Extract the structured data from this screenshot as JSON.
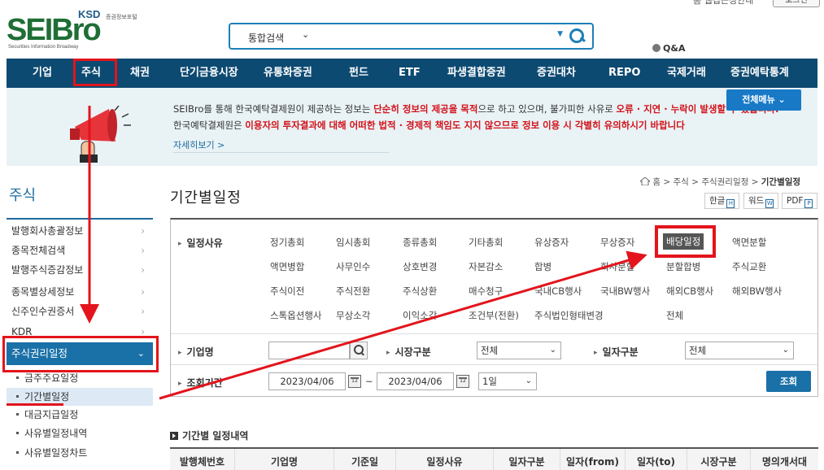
{
  "header": {
    "logo_main": "SEIBro",
    "logo_ksd": "KSD",
    "logo_ksd_sub": "증권정보포털",
    "logo_tagline": "Securities Information Broadway",
    "search_scope": "통합검색",
    "qa_label": "Q&A",
    "top_links": "홈  웹접근성안내",
    "login_label": "로그인"
  },
  "nav": {
    "items": [
      "기업",
      "주식",
      "채권",
      "단기금융시장",
      "유통화증권",
      "펀드",
      "ETF",
      "파생결합증권",
      "증권대차",
      "REPO",
      "국제거래",
      "증권예탁통계"
    ]
  },
  "notice": {
    "line1_a": "SEIBro를 통해 한국예탁결제원이 제공하는 정보는 ",
    "line1_b": "단순히 정보의 제공을 목적",
    "line1_c": "으로 하고 있으며, 불가피한 사유로 ",
    "line1_d": "오류 · 지연 · 누락이 발생할 수 있습니다.",
    "line2_a": "한국예탁결제원은 ",
    "line2_b": "이용자의 투자결과에 대해 어떠한 법적 · 경제적 책임도 지지 않으므로 정보 이용 시 각별히 유의하시기 바랍니다",
    "more": "자세히보기  >",
    "full_menu": "전체메뉴  ⌄"
  },
  "sidebar": {
    "title": "주식",
    "items": [
      "발행회사총괄정보",
      "종목전체검색",
      "발행주식증감정보",
      "종목별상세정보",
      "신주인수권증서",
      "KDR"
    ],
    "active": "주식권리일정",
    "sub_items": [
      "금주주요일정",
      "기간별일정",
      "대금지급일정",
      "사유별일정내역",
      "사유별일정차트"
    ]
  },
  "main": {
    "title": "기간별일정",
    "breadcrumb": {
      "home": "홈",
      "level1": "주식",
      "level2": "주식권리일정",
      "current": "기간별일정"
    },
    "downloads": [
      "한글",
      "워드",
      "PDF"
    ],
    "filter": {
      "reason_label": "일정사유",
      "reasons": [
        [
          "정기총회",
          "임시총회",
          "종류총회",
          "기타총회",
          "유상증자",
          "무상증자",
          "배당일정",
          "액면분할"
        ],
        [
          "액면병합",
          "사무인수",
          "상호변경",
          "자본감소",
          "합병",
          "회사분할",
          "분할합병",
          "주식교환"
        ],
        [
          "주식이전",
          "주식전환",
          "주식상환",
          "매수청구",
          "국내CB행사",
          "국내BW행사",
          "해외CB행사",
          "해외BW행사"
        ],
        [
          "스톡옵션행사",
          "무상소각",
          "이익소각",
          "조건부(전환)",
          "주식법인형태변경",
          "",
          "전체",
          ""
        ]
      ],
      "company_label": "기업명",
      "company_value": "",
      "market_label": "시장구분",
      "market_value": "전체",
      "date_type_label": "일자구분",
      "date_type_value": "전체",
      "period_label": "조회기간",
      "date_from": "2023/04/06",
      "date_to": "2023/04/06",
      "tilde": "~",
      "period_unit": "1일",
      "search_button": "조회"
    },
    "result_title": "기간별 일정내역",
    "table_headers": [
      "발행체번호",
      "기업명",
      "기준일",
      "일정사유",
      "일자구분",
      "일자(from)",
      "일자(to)",
      "시장구분",
      "명의개서대"
    ]
  },
  "colors": {
    "nav_bg": "#0d4a72",
    "accent_blue": "#1a71a8",
    "annotation_red": "#e3141c",
    "notice_bg": "#e9f2f5"
  }
}
